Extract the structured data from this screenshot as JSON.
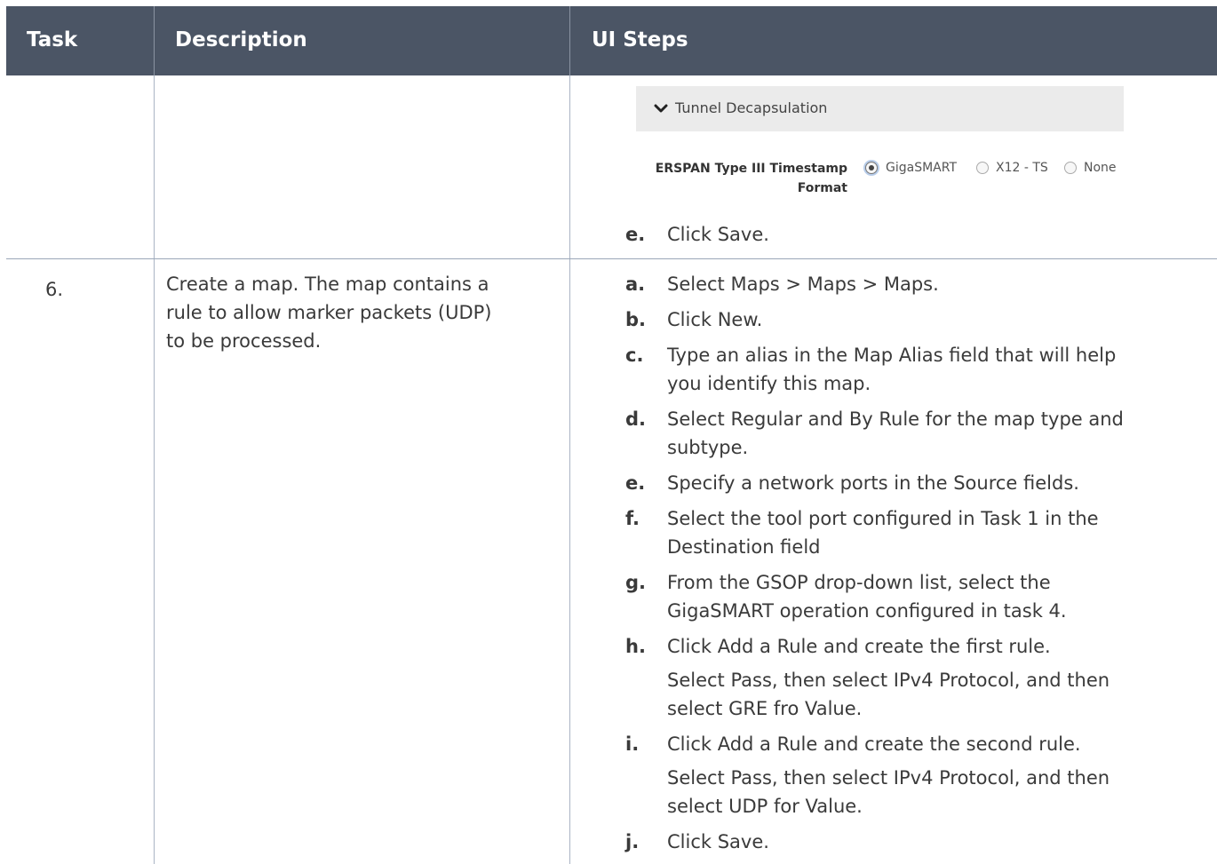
{
  "header": {
    "task": "Task",
    "description": "Description",
    "ui_steps": "UI Steps"
  },
  "snippet": {
    "section_title": "Tunnel Decapsulation",
    "timestamp_label_line1": "ERSPAN Type III Timestamp",
    "timestamp_label_line2": "Format",
    "options": [
      {
        "label": "GigaSMART",
        "selected": true
      },
      {
        "label": "X12 - TS",
        "selected": false
      },
      {
        "label": "None",
        "selected": false
      }
    ]
  },
  "row5": {
    "step_e_letter": "e.",
    "step_e_text": "Click Save."
  },
  "row6": {
    "number": "6.",
    "description_lines": [
      "Create a map. The map contains a",
      "rule to allow marker packets (UDP)",
      "to be processed."
    ],
    "steps": [
      {
        "letter": "a.",
        "lines": [
          "Select Maps > Maps > Maps."
        ]
      },
      {
        "letter": "b.",
        "lines": [
          "Click New."
        ]
      },
      {
        "letter": "c.",
        "lines": [
          "Type an alias in the Map Alias field that will help",
          "you identify this map."
        ]
      },
      {
        "letter": "d.",
        "lines": [
          "Select Regular and By Rule for the map type and",
          "subtype."
        ]
      },
      {
        "letter": "e.",
        "lines": [
          "Specify a network ports in the Source fields."
        ]
      },
      {
        "letter": "f.",
        "lines": [
          "Select the tool port configured in Task 1 in the",
          "Destination field"
        ]
      },
      {
        "letter": "g.",
        "lines": [
          "From the GSOP drop-down list, select the",
          "GigaSMART operation configured in task 4."
        ]
      },
      {
        "letter": "h.",
        "lines": [
          "Click Add a Rule and create the first rule."
        ]
      },
      {
        "letter": "",
        "lines": [
          "Select Pass, then select IPv4 Protocol, and then",
          "select GRE fro Value."
        ]
      },
      {
        "letter": "i.",
        "lines": [
          "Click Add a Rule and create the second rule."
        ]
      },
      {
        "letter": "",
        "lines": [
          "Select Pass, then select IPv4 Protocol, and then",
          "select UDP for Value."
        ]
      },
      {
        "letter": "j.",
        "lines": [
          "Click Save."
        ]
      }
    ]
  }
}
